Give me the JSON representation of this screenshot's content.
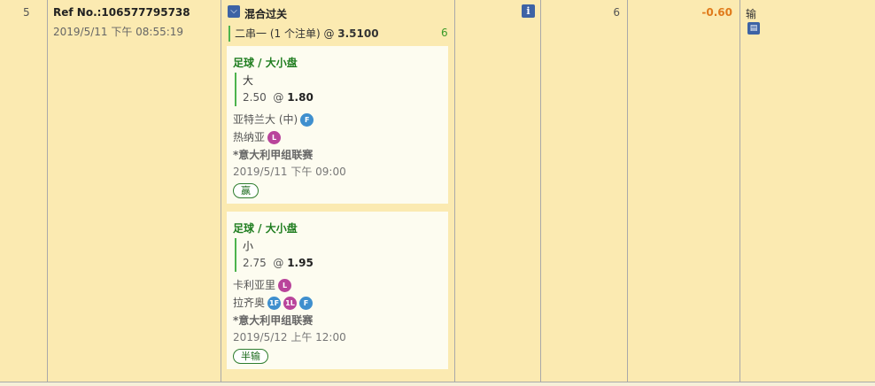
{
  "row": {
    "index": "5",
    "ref_no": "Ref No.:106577795738",
    "bet_time": "2019/5/11 下午 08:55:19",
    "bet_type": "混合过关",
    "parlay_desc": "二串一 (1 个注单) @ ",
    "parlay_odds": "3.5100",
    "parlay_count": "6",
    "count": "6",
    "amount": "-0.60",
    "result": "输",
    "note_icon": "note-icon",
    "legs": [
      {
        "sport": "足球 / 大小盘",
        "selection": "大",
        "handicap": "2.50",
        "at": "@ ",
        "odds": "1.80",
        "team1": "亚特兰大 (中)",
        "team1_badges": [
          "F"
        ],
        "team2": "热纳亚",
        "team2_badges": [
          "L"
        ],
        "league": "*意大利甲组联赛",
        "kickoff": "2019/5/11 下午 09:00",
        "status": "赢"
      },
      {
        "sport": "足球 / 大小盘",
        "selection": "小",
        "handicap": "2.75",
        "at": "@ ",
        "odds": "1.95",
        "team1": "卡利亚里",
        "team1_badges": [
          "L"
        ],
        "team2": "拉齐奥",
        "team2_badges": [
          "1F",
          "1L",
          "F"
        ],
        "league": "*意大利甲组联赛",
        "kickoff": "2019/5/12 上午 12:00",
        "status": "半输"
      }
    ]
  },
  "colors": {
    "row_bg": "#fbeab1",
    "leg_bg": "#fdfcf0",
    "sport_green": "#1f7d1f",
    "loss_orange": "#e07a1a",
    "icon_blue": "#3d63a5",
    "badge_blue": "#3f8fce",
    "badge_magenta": "#b9449b"
  }
}
